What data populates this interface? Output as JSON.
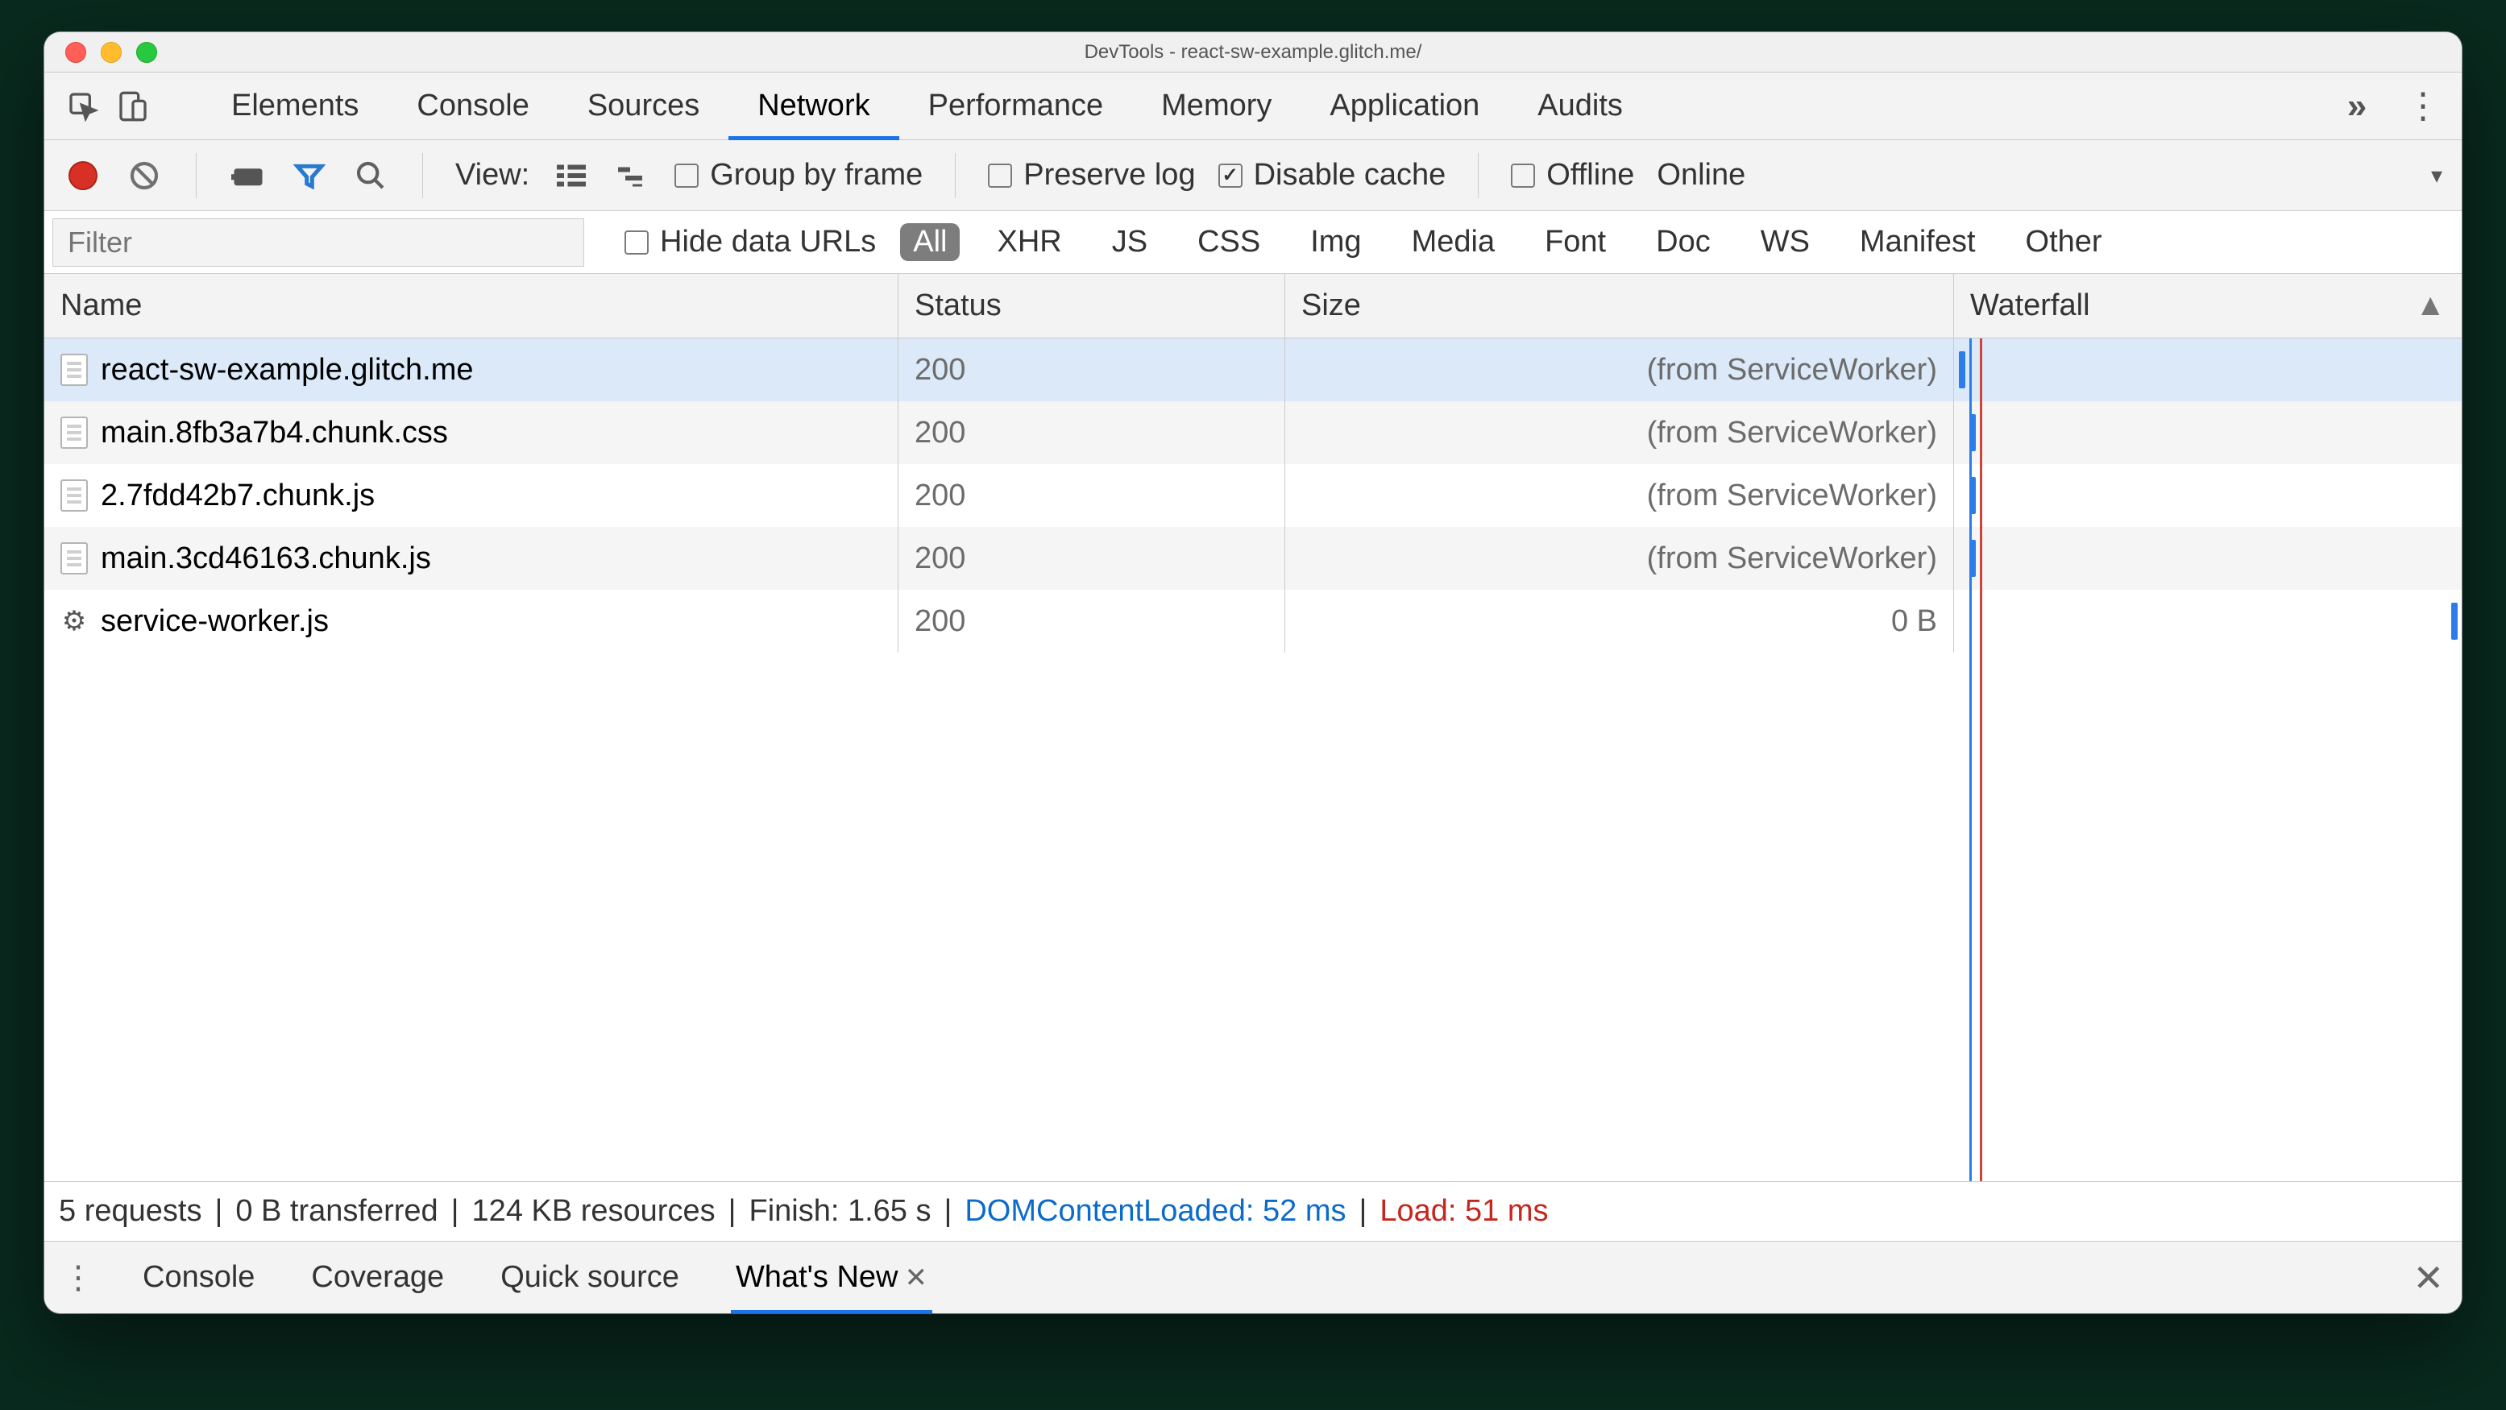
{
  "window": {
    "title": "DevTools - react-sw-example.glitch.me/"
  },
  "tabs": {
    "items": [
      "Elements",
      "Console",
      "Sources",
      "Network",
      "Performance",
      "Memory",
      "Application",
      "Audits"
    ],
    "active": "Network"
  },
  "toolbar": {
    "view_label": "View:",
    "group_by_frame": "Group by frame",
    "preserve_log": "Preserve log",
    "disable_cache": "Disable cache",
    "disable_cache_checked": true,
    "offline": "Offline",
    "online": "Online",
    "filter_placeholder": "Filter",
    "hide_data_urls": "Hide data URLs",
    "types": [
      "All",
      "XHR",
      "JS",
      "CSS",
      "Img",
      "Media",
      "Font",
      "Doc",
      "WS",
      "Manifest",
      "Other"
    ],
    "type_active": "All"
  },
  "columns": {
    "name": "Name",
    "status": "Status",
    "size": "Size",
    "waterfall": "Waterfall"
  },
  "requests": [
    {
      "name": "react-sw-example.glitch.me",
      "status": "200",
      "size": "(from ServiceWorker)",
      "icon": "file",
      "wf_left_pct": 1,
      "selected": true
    },
    {
      "name": "main.8fb3a7b4.chunk.css",
      "status": "200",
      "size": "(from ServiceWorker)",
      "icon": "file",
      "wf_left_pct": 3
    },
    {
      "name": "2.7fdd42b7.chunk.js",
      "status": "200",
      "size": "(from ServiceWorker)",
      "icon": "file",
      "wf_left_pct": 3
    },
    {
      "name": "main.3cd46163.chunk.js",
      "status": "200",
      "size": "(from ServiceWorker)",
      "icon": "file",
      "wf_left_pct": 3
    },
    {
      "name": "service-worker.js",
      "status": "200",
      "size": "0 B",
      "icon": "gear",
      "wf_left_pct": 98
    }
  ],
  "waterfall_markers": {
    "red_pct": 5,
    "blue_pct": 3
  },
  "status": {
    "requests": "5 requests",
    "transferred": "0 B transferred",
    "resources": "124 KB resources",
    "finish": "Finish: 1.65 s",
    "dcl": "DOMContentLoaded: 52 ms",
    "load": "Load: 51 ms",
    "sep": " | "
  },
  "drawer": {
    "items": [
      "Console",
      "Coverage",
      "Quick source",
      "What's New"
    ],
    "active": "What's New"
  }
}
